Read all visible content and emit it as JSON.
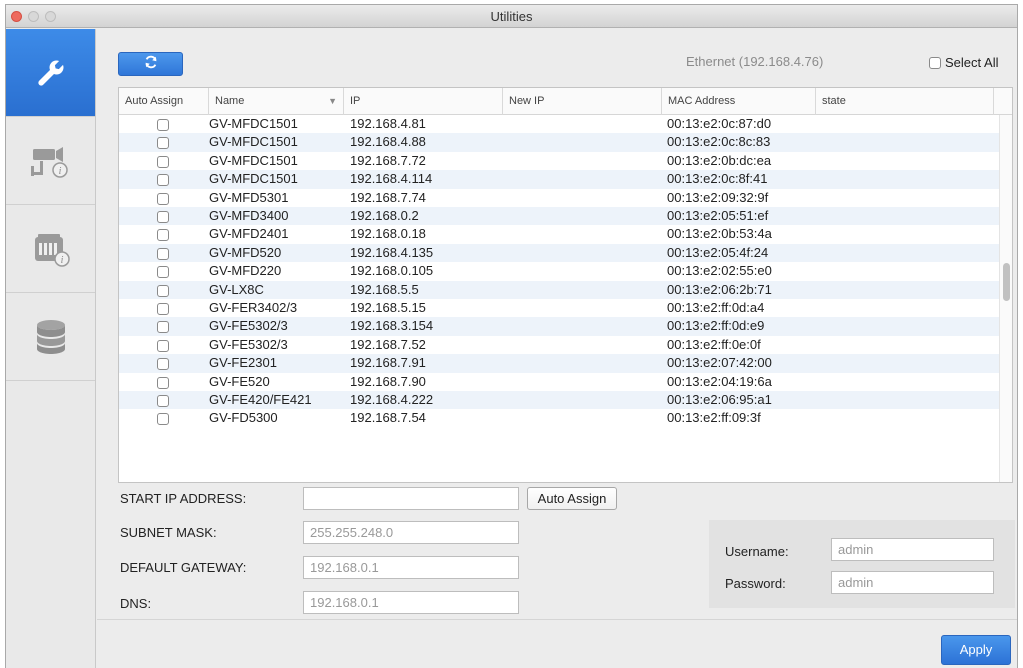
{
  "window": {
    "title": "Utilities"
  },
  "sidebar": {
    "items": [
      {
        "name": "tools",
        "icon": "wrench-icon",
        "active": true
      },
      {
        "name": "camera-info",
        "icon": "camera-info-icon",
        "active": false
      },
      {
        "name": "device-info",
        "icon": "device-info-icon",
        "active": false
      },
      {
        "name": "database",
        "icon": "database-icon",
        "active": false
      }
    ]
  },
  "toolbar": {
    "refresh_icon": "refresh-icon",
    "ethernet": "Ethernet (192.168.4.76)",
    "select_all_label": "Select All"
  },
  "table": {
    "columns": [
      "Auto Assign",
      "Name",
      "IP",
      "New IP",
      "MAC Address",
      "state"
    ],
    "rows": [
      {
        "name": "GV-MFDC1501",
        "ip": "192.168.4.81",
        "new_ip": "",
        "mac": "00:13:e2:0c:87:d0",
        "state": ""
      },
      {
        "name": "GV-MFDC1501",
        "ip": "192.168.4.88",
        "new_ip": "",
        "mac": "00:13:e2:0c:8c:83",
        "state": ""
      },
      {
        "name": "GV-MFDC1501",
        "ip": "192.168.7.72",
        "new_ip": "",
        "mac": "00:13:e2:0b:dc:ea",
        "state": ""
      },
      {
        "name": "GV-MFDC1501",
        "ip": "192.168.4.114",
        "new_ip": "",
        "mac": "00:13:e2:0c:8f:41",
        "state": ""
      },
      {
        "name": "GV-MFD5301",
        "ip": "192.168.7.74",
        "new_ip": "",
        "mac": "00:13:e2:09:32:9f",
        "state": ""
      },
      {
        "name": "GV-MFD3400",
        "ip": "192.168.0.2",
        "new_ip": "",
        "mac": "00:13:e2:05:51:ef",
        "state": ""
      },
      {
        "name": "GV-MFD2401",
        "ip": "192.168.0.18",
        "new_ip": "",
        "mac": "00:13:e2:0b:53:4a",
        "state": ""
      },
      {
        "name": "GV-MFD520",
        "ip": "192.168.4.135",
        "new_ip": "",
        "mac": "00:13:e2:05:4f:24",
        "state": ""
      },
      {
        "name": "GV-MFD220",
        "ip": "192.168.0.105",
        "new_ip": "",
        "mac": "00:13:e2:02:55:e0",
        "state": ""
      },
      {
        "name": "GV-LX8C",
        "ip": "192.168.5.5",
        "new_ip": "",
        "mac": "00:13:e2:06:2b:71",
        "state": ""
      },
      {
        "name": "GV-FER3402/3",
        "ip": "192.168.5.15",
        "new_ip": "",
        "mac": "00:13:e2:ff:0d:a4",
        "state": ""
      },
      {
        "name": "GV-FE5302/3",
        "ip": "192.168.3.154",
        "new_ip": "",
        "mac": "00:13:e2:ff:0d:e9",
        "state": ""
      },
      {
        "name": "GV-FE5302/3",
        "ip": "192.168.7.52",
        "new_ip": "",
        "mac": "00:13:e2:ff:0e:0f",
        "state": ""
      },
      {
        "name": "GV-FE2301",
        "ip": "192.168.7.91",
        "new_ip": "",
        "mac": "00:13:e2:07:42:00",
        "state": ""
      },
      {
        "name": "GV-FE520",
        "ip": "192.168.7.90",
        "new_ip": "",
        "mac": "00:13:e2:04:19:6a",
        "state": ""
      },
      {
        "name": "GV-FE420/FE421",
        "ip": "192.168.4.222",
        "new_ip": "",
        "mac": "00:13:e2:06:95:a1",
        "state": ""
      },
      {
        "name": "GV-FD5300",
        "ip": "192.168.7.54",
        "new_ip": "",
        "mac": "00:13:e2:ff:09:3f",
        "state": ""
      }
    ]
  },
  "form": {
    "start_ip_label": "START IP ADDRESS:",
    "start_ip_value": "",
    "auto_assign_button": "Auto Assign",
    "subnet_label": "SUBNET MASK:",
    "subnet_value": "255.255.248.0",
    "gateway_label": "DEFAULT GATEWAY:",
    "gateway_value": "192.168.0.1",
    "dns_label": "DNS:",
    "dns_value": "192.168.0.1"
  },
  "credentials": {
    "username_label": "Username:",
    "username_value": "admin",
    "password_label": "Password:",
    "password_value": "admin"
  },
  "footer": {
    "apply_label": "Apply"
  },
  "colors": {
    "accent": "#2f76d8",
    "row_alt": "#edf3fa"
  }
}
